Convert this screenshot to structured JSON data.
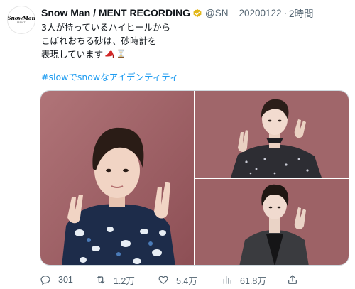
{
  "tweet": {
    "avatar": {
      "logo_text": "SnowMan",
      "logo_sub": "MENT"
    },
    "author": {
      "name": "Snow Man / MENT RECORDING",
      "handle": "@SN__20200122",
      "separator": "·",
      "time": "2時間",
      "verified": true
    },
    "text_lines": [
      "3人が持っているハイヒールから",
      "こぼれおちる砂は、砂時計を",
      "表現しています"
    ],
    "emojis": [
      "high-heel",
      "hourglass"
    ],
    "hashtag": "#slowでsnowなアイデンティティ",
    "media": {
      "count": 3
    },
    "actions": {
      "replies": "301",
      "retweets": "1.2万",
      "likes": "5.4万",
      "views": "61.8万"
    }
  },
  "colors": {
    "text": "#0f1419",
    "secondary": "#536471",
    "link": "#1d9bf0",
    "verified_gold": "#e2b719",
    "photo_wall": "#9e5e62",
    "border": "#cfd9de"
  }
}
